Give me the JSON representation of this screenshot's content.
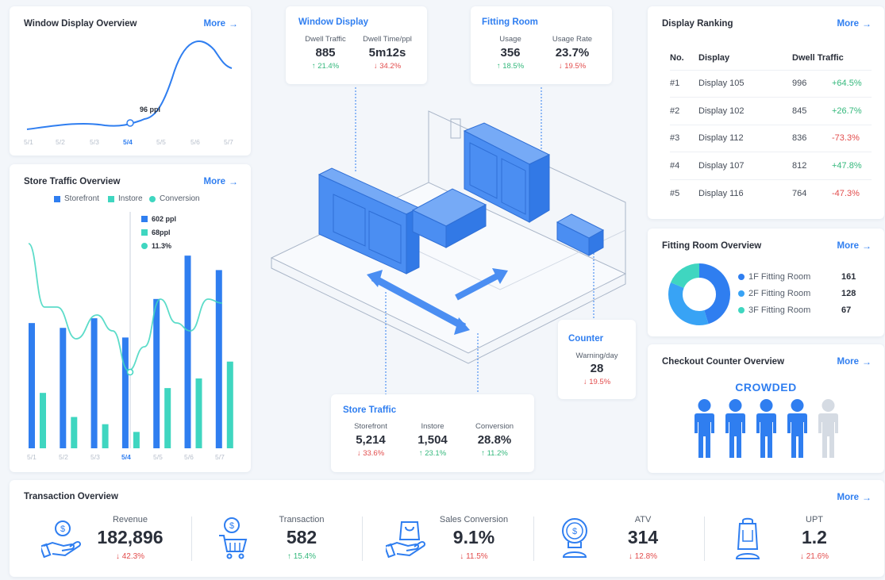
{
  "colors": {
    "accent": "#2f7ef0",
    "accent_light": "#38a3f5",
    "teal": "#3fd6c0",
    "up": "#34b87c",
    "down": "#e24c4c"
  },
  "window_display_overview": {
    "title": "Window Display Overview",
    "more": "More",
    "tooltip": "96 ppl",
    "x_labels": [
      "5/1",
      "5/2",
      "5/3",
      "5/4",
      "5/5",
      "5/6",
      "5/7"
    ],
    "active_label": "5/4"
  },
  "store_traffic_overview": {
    "title": "Store Traffic Overview",
    "more": "More",
    "legend": [
      "Storefront",
      "Instore",
      "Conversion"
    ],
    "tooltip": [
      "602 ppl",
      "68ppl",
      "11.3%"
    ],
    "x_labels": [
      "5/1",
      "5/2",
      "5/3",
      "5/4",
      "5/5",
      "5/6",
      "5/7"
    ]
  },
  "chart_data": {
    "type": "bar",
    "categories": [
      "5/1",
      "5/2",
      "5/3",
      "5/4",
      "5/5",
      "5/6",
      "5/7"
    ],
    "series": [
      {
        "name": "Storefront",
        "values": [
          520,
          500,
          540,
          460,
          620,
          800,
          740
        ]
      },
      {
        "name": "Instore",
        "values": [
          230,
          130,
          100,
          68,
          250,
          290,
          360
        ]
      },
      {
        "name": "Conversion",
        "values": [
          18,
          14,
          13,
          11.3,
          16,
          14,
          18
        ]
      }
    ]
  },
  "window_display_card": {
    "title": "Window Display",
    "stats": [
      {
        "label": "Dwell Traffic",
        "value": "885",
        "delta": "↑ 21.4%",
        "dir": "up"
      },
      {
        "label": "Dwell Time/ppl",
        "value": "5m12s",
        "delta": "↓ 34.2%",
        "dir": "down"
      }
    ]
  },
  "fitting_room_card": {
    "title": "Fitting Room",
    "stats": [
      {
        "label": "Usage",
        "value": "356",
        "delta": "↑ 18.5%",
        "dir": "up"
      },
      {
        "label": "Usage Rate",
        "value": "23.7%",
        "delta": "↓ 19.5%",
        "dir": "down"
      }
    ]
  },
  "counter_card": {
    "title": "Counter",
    "label": "Warning/day",
    "value": "28",
    "delta": "↓ 19.5%"
  },
  "store_traffic_card": {
    "title": "Store Traffic",
    "stats": [
      {
        "label": "Storefront",
        "value": "5,214",
        "delta": "↓ 33.6%",
        "dir": "down"
      },
      {
        "label": "Instore",
        "value": "1,504",
        "delta": "↑ 23.1%",
        "dir": "up"
      },
      {
        "label": "Conversion",
        "value": "28.8%",
        "delta": "↑ 11.2%",
        "dir": "up"
      }
    ]
  },
  "display_ranking": {
    "title": "Display Ranking",
    "more": "More",
    "columns": [
      "No.",
      "Display",
      "Dwell Traffic"
    ],
    "rows": [
      {
        "no": "#1",
        "display": "Display 105",
        "traffic": "996",
        "delta": "+64.5%",
        "dir": "up"
      },
      {
        "no": "#2",
        "display": "Display 102",
        "traffic": "845",
        "delta": "+26.7%",
        "dir": "up"
      },
      {
        "no": "#3",
        "display": "Display 112",
        "traffic": "836",
        "delta": "-73.3%",
        "dir": "down"
      },
      {
        "no": "#4",
        "display": "Display 107",
        "traffic": "812",
        "delta": "+47.8%",
        "dir": "up"
      },
      {
        "no": "#5",
        "display": "Display 116",
        "traffic": "764",
        "delta": "-47.3%",
        "dir": "down"
      }
    ]
  },
  "fitting_room_overview": {
    "title": "Fitting Room Overview",
    "more": "More",
    "items": [
      {
        "label": "1F Fitting Room",
        "value": "161",
        "color": "#2f7ef0"
      },
      {
        "label": "2F Fitting Room",
        "value": "128",
        "color": "#38a3f5"
      },
      {
        "label": "3F Fitting Room",
        "value": "67",
        "color": "#3fd6c0"
      }
    ]
  },
  "checkout_counter_overview": {
    "title": "Checkout Counter Overview",
    "more": "More",
    "status": "CROWDED",
    "people_active": 4,
    "people_total": 5
  },
  "transaction_overview": {
    "title": "Transaction Overview",
    "more": "More",
    "kpis": [
      {
        "icon": "hand-coin-icon",
        "label": "Revenue",
        "value": "182,896",
        "delta": "↓ 42.3%",
        "dir": "down"
      },
      {
        "icon": "cart-coin-icon",
        "label": "Transaction",
        "value": "582",
        "delta": "↑ 15.4%",
        "dir": "up"
      },
      {
        "icon": "hand-bag-icon",
        "label": "Sales Conversion",
        "value": "9.1%",
        "delta": "↓ 11.5%",
        "dir": "down"
      },
      {
        "icon": "coin-stack-icon",
        "label": "ATV",
        "value": "314",
        "delta": "↓ 12.8%",
        "dir": "down"
      },
      {
        "icon": "shopping-bag-icon",
        "label": "UPT",
        "value": "1.2",
        "delta": "↓ 21.6%",
        "dir": "down"
      }
    ]
  }
}
